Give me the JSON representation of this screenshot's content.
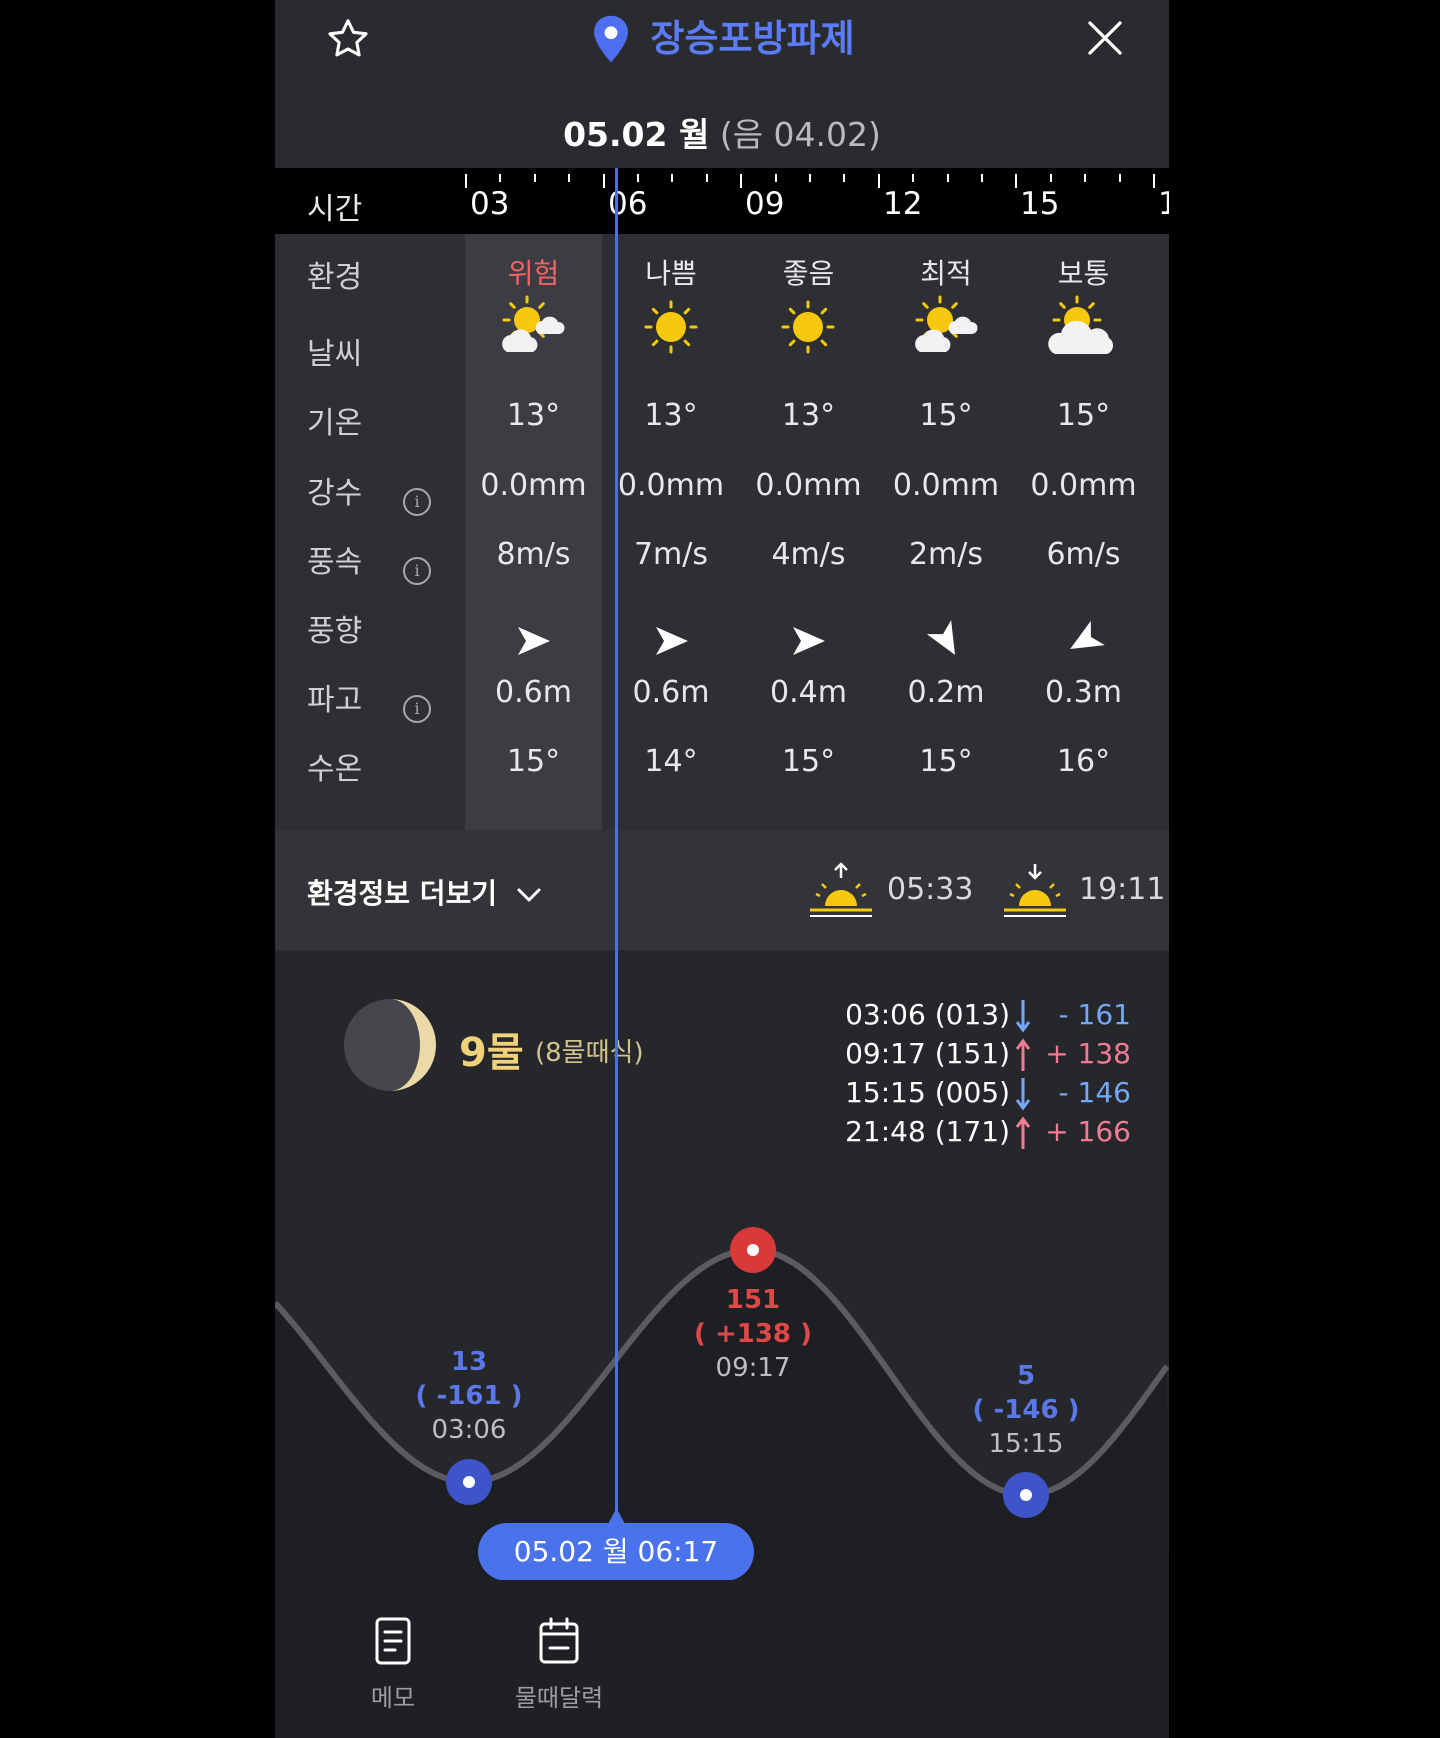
{
  "header": {
    "location_name": "장승포방파제",
    "date": "05.02 월",
    "lunar_date": "(음  04.02)",
    "icons": {
      "favorite": "star-icon",
      "location": "location-pin-icon",
      "close": "close-icon"
    }
  },
  "timeline": {
    "label": "시간",
    "hours": [
      "03",
      "06",
      "09",
      "12",
      "15",
      "1"
    ]
  },
  "rows": {
    "labels": [
      "환경",
      "날씨",
      "기온",
      "강수",
      "풍속",
      "풍향",
      "파고",
      "수온"
    ],
    "env": [
      "위험",
      "나쁨",
      "좋음",
      "최적",
      "보통"
    ],
    "env_colors": [
      "#f26464",
      "#e8e8ea",
      "#e8e8ea",
      "#e8e8ea",
      "#e8e8ea"
    ],
    "weather": [
      "partly-sunny-icon",
      "sunny-icon",
      "sunny-icon",
      "partly-sunny-icon",
      "mostly-cloudy-icon"
    ],
    "temp": [
      "13°",
      "13°",
      "13°",
      "15°",
      "15°"
    ],
    "rain": [
      "0.0mm",
      "0.0mm",
      "0.0mm",
      "0.0mm",
      "0.0mm"
    ],
    "wind_speed": [
      "8m/s",
      "7m/s",
      "4m/s",
      "2m/s",
      "6m/s"
    ],
    "wind_dir_deg": [
      0,
      0,
      0,
      60,
      150
    ],
    "wave": [
      "0.6m",
      "0.6m",
      "0.4m",
      "0.2m",
      "0.3m"
    ],
    "water_temp": [
      "15°",
      "14°",
      "15°",
      "15°",
      "16°"
    ]
  },
  "more": {
    "label": "환경정보 더보기",
    "sunrise": "05:33",
    "sunset": "19:11"
  },
  "tide": {
    "moon_phase_label": "9물",
    "moon_phase_sub": "(8물때식)",
    "times": [
      {
        "time": "03:06 (013)",
        "dir": "down",
        "diff": "- 161"
      },
      {
        "time": "09:17 (151)",
        "dir": "up",
        "diff": "+ 138"
      },
      {
        "time": "15:15 (005)",
        "dir": "down",
        "diff": "- 146"
      },
      {
        "time": "21:48  (171)",
        "dir": "up",
        "diff": "+ 166"
      }
    ],
    "points": [
      {
        "value": "13",
        "change": "( -161 )",
        "time": "03:06",
        "kind": "low"
      },
      {
        "value": "151",
        "change": "( +138 )",
        "time": "09:17",
        "kind": "high"
      },
      {
        "value": "5",
        "change": "( -146 )",
        "time": "15:15",
        "kind": "low"
      }
    ],
    "current": "05.02 월 06:17"
  },
  "nav": {
    "memo": "메모",
    "calendar": "물때달력"
  },
  "colors": {
    "accent": "#4a72ea",
    "danger": "#f26464",
    "high_tide": "#e04848",
    "low_tide": "#4a62d8"
  }
}
